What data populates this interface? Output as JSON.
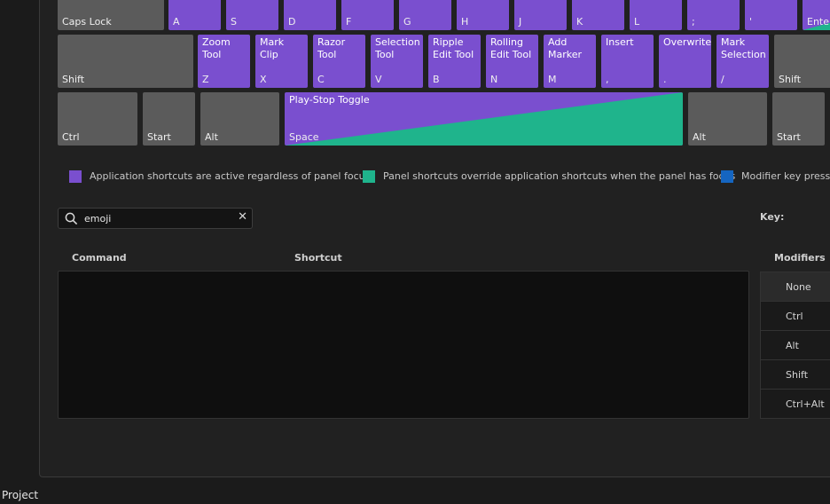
{
  "keyboard": {
    "row1": [
      {
        "label": "Caps Lock",
        "cmd": ""
      },
      {
        "label": "A",
        "cmd": ""
      },
      {
        "label": "S",
        "cmd": ""
      },
      {
        "label": "D",
        "cmd": ""
      },
      {
        "label": "F",
        "cmd": ""
      },
      {
        "label": "G",
        "cmd": ""
      },
      {
        "label": "H",
        "cmd": ""
      },
      {
        "label": "J",
        "cmd": ""
      },
      {
        "label": "K",
        "cmd": ""
      },
      {
        "label": "L",
        "cmd": ""
      },
      {
        "label": ";",
        "cmd": ""
      },
      {
        "label": "'",
        "cmd": ""
      },
      {
        "label": "Enter",
        "cmd": ""
      }
    ],
    "row2": [
      {
        "label": "Shift",
        "cmd": ""
      },
      {
        "label": "Z",
        "cmd": "Zoom\nTool"
      },
      {
        "label": "X",
        "cmd": "Mark Clip"
      },
      {
        "label": "C",
        "cmd": "Razor\nTool"
      },
      {
        "label": "V",
        "cmd": "Selection\nTool"
      },
      {
        "label": "B",
        "cmd": "Ripple\nEdit Tool"
      },
      {
        "label": "N",
        "cmd": "Rolling\nEdit Tool"
      },
      {
        "label": "M",
        "cmd": "Add\nMarker"
      },
      {
        "label": ",",
        "cmd": "Insert"
      },
      {
        "label": ".",
        "cmd": "Overwrite"
      },
      {
        "label": "/",
        "cmd": "Mark\nSelection"
      },
      {
        "label": "Shift",
        "cmd": ""
      }
    ],
    "row3": [
      {
        "label": "Ctrl",
        "cmd": ""
      },
      {
        "label": "Start",
        "cmd": ""
      },
      {
        "label": "Alt",
        "cmd": ""
      },
      {
        "label": "Space",
        "cmd": "Play-Stop Toggle"
      },
      {
        "label": "Alt",
        "cmd": ""
      },
      {
        "label": "Start",
        "cmd": ""
      }
    ]
  },
  "legend": [
    {
      "text": "Application shortcuts are active regardless of panel focus",
      "color": "#7a4fcf"
    },
    {
      "text": "Panel shortcuts override application shortcuts when the panel has focus",
      "color": "#1fb48c"
    },
    {
      "text": "Modifier key pressed",
      "color": "#1565c0"
    }
  ],
  "search": {
    "value": "emoji",
    "clear": "✕"
  },
  "key_label": "Key:",
  "columns": {
    "command": "Command",
    "shortcut": "Shortcut",
    "modifiers": "Modifiers"
  },
  "modifiers": [
    "None",
    "Ctrl",
    "Alt",
    "Shift",
    "Ctrl+Alt"
  ],
  "selected_modifier": "None",
  "panel_tab": "Project",
  "colors": {
    "app": "#7a4fcf",
    "panel": "#1fb48c",
    "modifier": "#1565c0",
    "key": "#5b5b5b"
  }
}
